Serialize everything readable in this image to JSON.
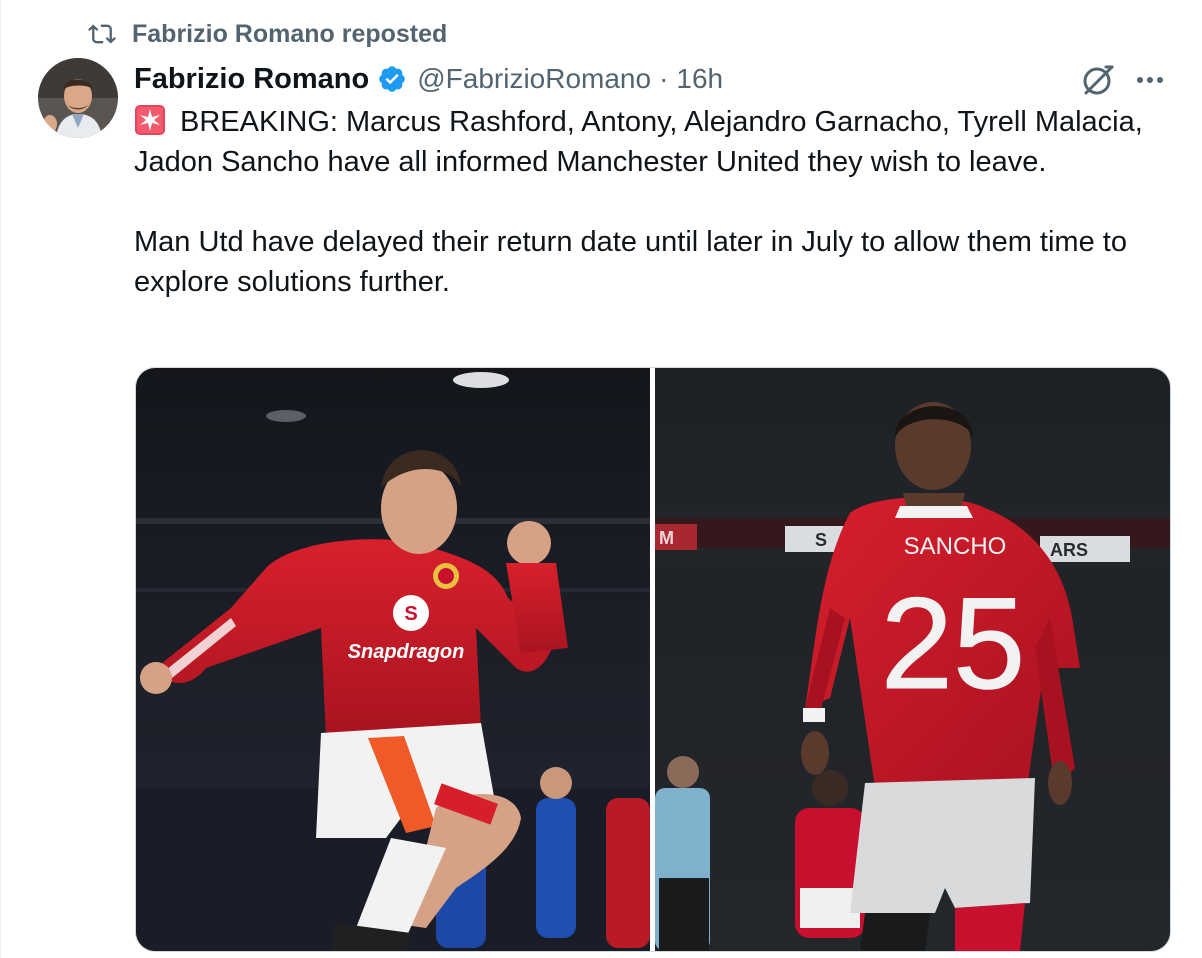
{
  "repost": {
    "text": "Fabrizio Romano reposted"
  },
  "tweet": {
    "author_name": "Fabrizio Romano",
    "handle": "@FabrizioRomano",
    "separator": "·",
    "time": "16h",
    "paragraphs": [
      "BREAKING: Marcus Rashford, Antony, Alejandro Garnacho, Tyrell Malacia, Jadon Sancho have all informed Manchester United they wish to leave.",
      "Man Utd have delayed their return date until later in July to allow them time to explore solutions further."
    ]
  },
  "media": {
    "left": {
      "sponsor_text": "Snapdragon"
    },
    "right": {
      "shirt_name": "SANCHO",
      "shirt_number": "25",
      "banner_left": "M",
      "banner_mid": "S",
      "banner_right": "ARS"
    }
  },
  "icons": {
    "repost": "repost-icon",
    "verified": "verified-badge-icon",
    "grok": "grok-icon",
    "more": "more-options-icon",
    "siren": "siren-emoji-icon"
  },
  "colors": {
    "verified_blue": "#1d9bf0",
    "secondary_text": "#536471",
    "man_utd_red": "#c8102e"
  }
}
